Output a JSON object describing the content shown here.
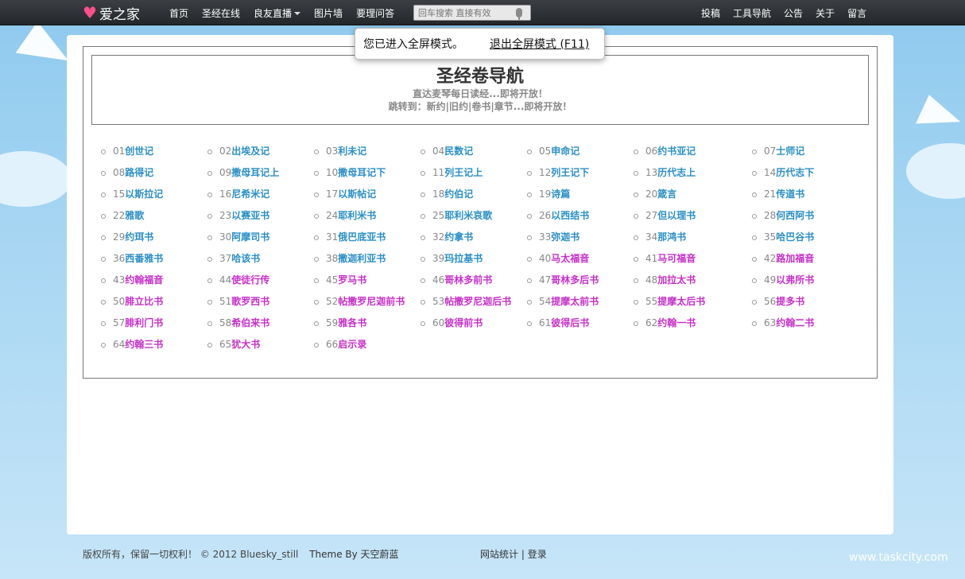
{
  "site": {
    "logo_text": "爱之家"
  },
  "nav": {
    "left": [
      "首页",
      "圣经在线",
      "良友直播",
      "图片墙",
      "要理问答"
    ],
    "search_placeholder": "回车搜索 直接有效",
    "right": [
      "投稿",
      "工具导航",
      "公告",
      "关于",
      "留言"
    ]
  },
  "fullscreen": {
    "message": "您已进入全屏模式。",
    "exit_label": "退出全屏模式 (F11)"
  },
  "page": {
    "title": "圣经卷导航",
    "subtitle1": "直达麦琴每日读经...即将开放！",
    "subtitle2": "跳转到：新约|旧约|卷书|章节...即将开放！"
  },
  "books": [
    {
      "num": "01",
      "name": "创世记",
      "t": "ot"
    },
    {
      "num": "02",
      "name": "出埃及记",
      "t": "ot"
    },
    {
      "num": "03",
      "name": "利未记",
      "t": "ot"
    },
    {
      "num": "04",
      "name": "民数记",
      "t": "ot"
    },
    {
      "num": "05",
      "name": "申命记",
      "t": "ot"
    },
    {
      "num": "06",
      "name": "约书亚记",
      "t": "ot"
    },
    {
      "num": "07",
      "name": "士师记",
      "t": "ot"
    },
    {
      "num": "08",
      "name": "路得记",
      "t": "ot"
    },
    {
      "num": "09",
      "name": "撒母耳记上",
      "t": "ot"
    },
    {
      "num": "10",
      "name": "撒母耳记下",
      "t": "ot"
    },
    {
      "num": "11",
      "name": "列王记上",
      "t": "ot"
    },
    {
      "num": "12",
      "name": "列王记下",
      "t": "ot"
    },
    {
      "num": "13",
      "name": "历代志上",
      "t": "ot"
    },
    {
      "num": "14",
      "name": "历代志下",
      "t": "ot"
    },
    {
      "num": "15",
      "name": "以斯拉记",
      "t": "ot"
    },
    {
      "num": "16",
      "name": "尼希米记",
      "t": "ot"
    },
    {
      "num": "17",
      "name": "以斯帖记",
      "t": "ot"
    },
    {
      "num": "18",
      "name": "约伯记",
      "t": "ot"
    },
    {
      "num": "19",
      "name": "诗篇",
      "t": "ot"
    },
    {
      "num": "20",
      "name": "箴言",
      "t": "ot"
    },
    {
      "num": "21",
      "name": "传道书",
      "t": "ot"
    },
    {
      "num": "22",
      "name": "雅歌",
      "t": "ot"
    },
    {
      "num": "23",
      "name": "以赛亚书",
      "t": "ot"
    },
    {
      "num": "24",
      "name": "耶利米书",
      "t": "ot"
    },
    {
      "num": "25",
      "name": "耶利米哀歌",
      "t": "ot"
    },
    {
      "num": "26",
      "name": "以西结书",
      "t": "ot"
    },
    {
      "num": "27",
      "name": "但以理书",
      "t": "ot"
    },
    {
      "num": "28",
      "name": "何西阿书",
      "t": "ot"
    },
    {
      "num": "29",
      "name": "约珥书",
      "t": "ot"
    },
    {
      "num": "30",
      "name": "阿摩司书",
      "t": "ot"
    },
    {
      "num": "31",
      "name": "俄巴底亚书",
      "t": "ot"
    },
    {
      "num": "32",
      "name": "约拿书",
      "t": "ot"
    },
    {
      "num": "33",
      "name": "弥迦书",
      "t": "ot"
    },
    {
      "num": "34",
      "name": "那鸿书",
      "t": "ot"
    },
    {
      "num": "35",
      "name": "哈巴谷书",
      "t": "ot"
    },
    {
      "num": "36",
      "name": "西番雅书",
      "t": "ot"
    },
    {
      "num": "37",
      "name": "哈该书",
      "t": "ot"
    },
    {
      "num": "38",
      "name": "撒迦利亚书",
      "t": "ot"
    },
    {
      "num": "39",
      "name": "玛拉基书",
      "t": "ot"
    },
    {
      "num": "40",
      "name": "马太福音",
      "t": "nt"
    },
    {
      "num": "41",
      "name": "马可福音",
      "t": "nt"
    },
    {
      "num": "42",
      "name": "路加福音",
      "t": "nt"
    },
    {
      "num": "43",
      "name": "约翰福音",
      "t": "nt"
    },
    {
      "num": "44",
      "name": "使徒行传",
      "t": "nt"
    },
    {
      "num": "45",
      "name": "罗马书",
      "t": "nt"
    },
    {
      "num": "46",
      "name": "哥林多前书",
      "t": "nt"
    },
    {
      "num": "47",
      "name": "哥林多后书",
      "t": "nt"
    },
    {
      "num": "48",
      "name": "加拉太书",
      "t": "nt"
    },
    {
      "num": "49",
      "name": "以弗所书",
      "t": "nt"
    },
    {
      "num": "50",
      "name": "腓立比书",
      "t": "nt"
    },
    {
      "num": "51",
      "name": "歌罗西书",
      "t": "nt"
    },
    {
      "num": "52",
      "name": "帖撒罗尼迦前书",
      "t": "nt"
    },
    {
      "num": "53",
      "name": "帖撒罗尼迦后书",
      "t": "nt"
    },
    {
      "num": "54",
      "name": "提摩太前书",
      "t": "nt"
    },
    {
      "num": "55",
      "name": "提摩太后书",
      "t": "nt"
    },
    {
      "num": "56",
      "name": "提多书",
      "t": "nt"
    },
    {
      "num": "57",
      "name": "腓利门书",
      "t": "nt"
    },
    {
      "num": "58",
      "name": "希伯来书",
      "t": "nt"
    },
    {
      "num": "59",
      "name": "雅各书",
      "t": "nt"
    },
    {
      "num": "60",
      "name": "彼得前书",
      "t": "nt"
    },
    {
      "num": "61",
      "name": "彼得后书",
      "t": "nt"
    },
    {
      "num": "62",
      "name": "约翰一书",
      "t": "nt"
    },
    {
      "num": "63",
      "name": "约翰二书",
      "t": "nt"
    },
    {
      "num": "64",
      "name": "约翰三书",
      "t": "nt"
    },
    {
      "num": "65",
      "name": "犹大书",
      "t": "nt"
    },
    {
      "num": "66",
      "name": "启示录",
      "t": "nt"
    }
  ],
  "colors": {
    "ot": "#2a8fc7",
    "nt": "#c72fc9",
    "logo_heart": "#ff4f8a"
  },
  "footer": {
    "copyright": "版权所有，保留一切权利！ © 2012 Bluesky_still",
    "theme": "Theme By 天空蔚蓝",
    "stats": "网站统计",
    "sep": "|",
    "login": "登录"
  },
  "watermark": "www.taskcity.com"
}
